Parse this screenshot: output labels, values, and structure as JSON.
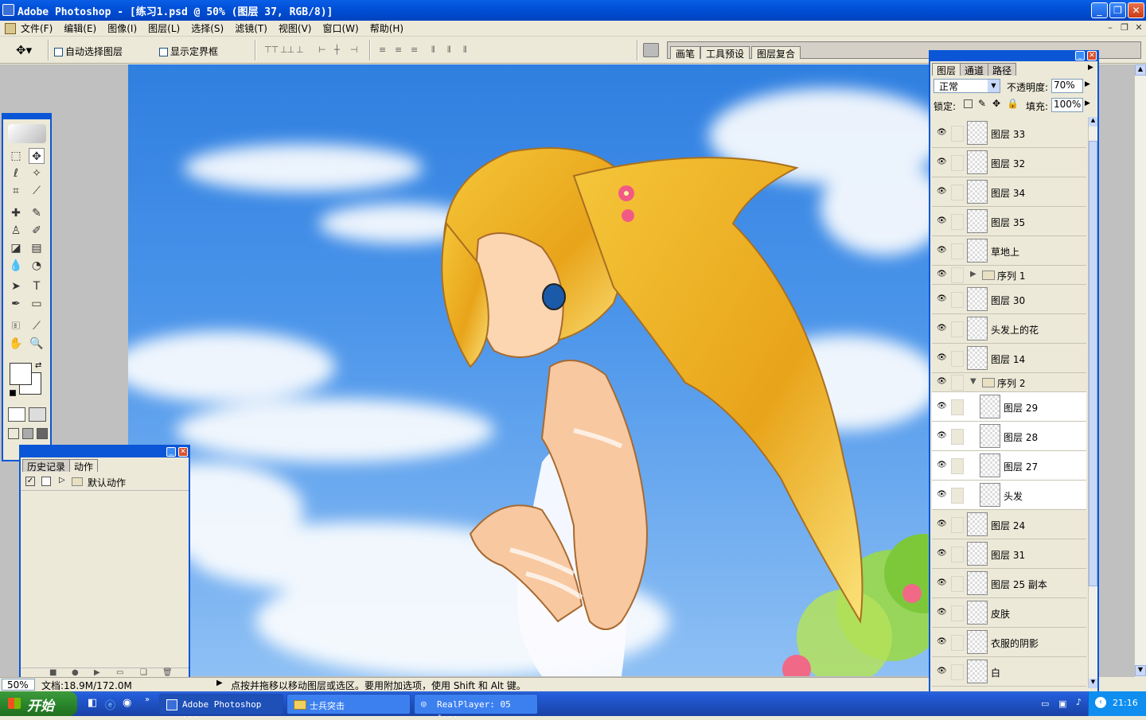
{
  "window": {
    "title": "Adobe Photoshop - [练习1.psd @ 50% (图层 37, RGB/8)]"
  },
  "menu": [
    "文件(F)",
    "编辑(E)",
    "图像(I)",
    "图层(L)",
    "选择(S)",
    "滤镜(T)",
    "视图(V)",
    "窗口(W)",
    "帮助(H)"
  ],
  "options": {
    "auto_select_label": "自动选择图层",
    "show_bounds_label": "显示定界框"
  },
  "palette_well": [
    "画笔",
    "工具预设",
    "图层复合"
  ],
  "history_panel": {
    "tabs": [
      "历史记录",
      "动作"
    ],
    "item": "默认动作"
  },
  "layers_panel": {
    "tabs": [
      "图层",
      "通道",
      "路径"
    ],
    "blend_mode": "正常",
    "opacity_label": "不透明度:",
    "opacity_value": "70%",
    "lock_label": "锁定:",
    "fill_label": "填充:",
    "fill_value": "100%",
    "layers": [
      {
        "name": "图层 33",
        "kind": "layer"
      },
      {
        "name": "图层 32",
        "kind": "layer"
      },
      {
        "name": "图层 34",
        "kind": "layer"
      },
      {
        "name": "图层 35",
        "kind": "layer"
      },
      {
        "name": "草地上",
        "kind": "layer"
      },
      {
        "name": "序列 1",
        "kind": "group"
      },
      {
        "name": "图层 30",
        "kind": "layer"
      },
      {
        "name": "头发上的花",
        "kind": "layer"
      },
      {
        "name": "图层 14",
        "kind": "layer"
      },
      {
        "name": "序列 2",
        "kind": "group-open"
      },
      {
        "name": "图层 29",
        "kind": "child"
      },
      {
        "name": "图层 28",
        "kind": "child"
      },
      {
        "name": "图层 27",
        "kind": "child"
      },
      {
        "name": "头发",
        "kind": "child"
      },
      {
        "name": "图层 24",
        "kind": "layer"
      },
      {
        "name": "图层 31",
        "kind": "layer"
      },
      {
        "name": "图层 25 副本",
        "kind": "layer"
      },
      {
        "name": "皮肤",
        "kind": "layer"
      },
      {
        "name": "衣服的阴影",
        "kind": "layer"
      },
      {
        "name": "白",
        "kind": "layer"
      }
    ]
  },
  "status": {
    "zoom": "50%",
    "doc": "文档:18.9M/172.0M",
    "hint": "点按并拖移以移动图层或选区。要用附加选项，使用 Shift 和 Alt 键。"
  },
  "taskbar": {
    "start": "开始",
    "buttons": [
      "Adobe Photoshop ...",
      "士兵突击",
      "RealPlayer: 05 -..."
    ],
    "clock": "21:16"
  }
}
